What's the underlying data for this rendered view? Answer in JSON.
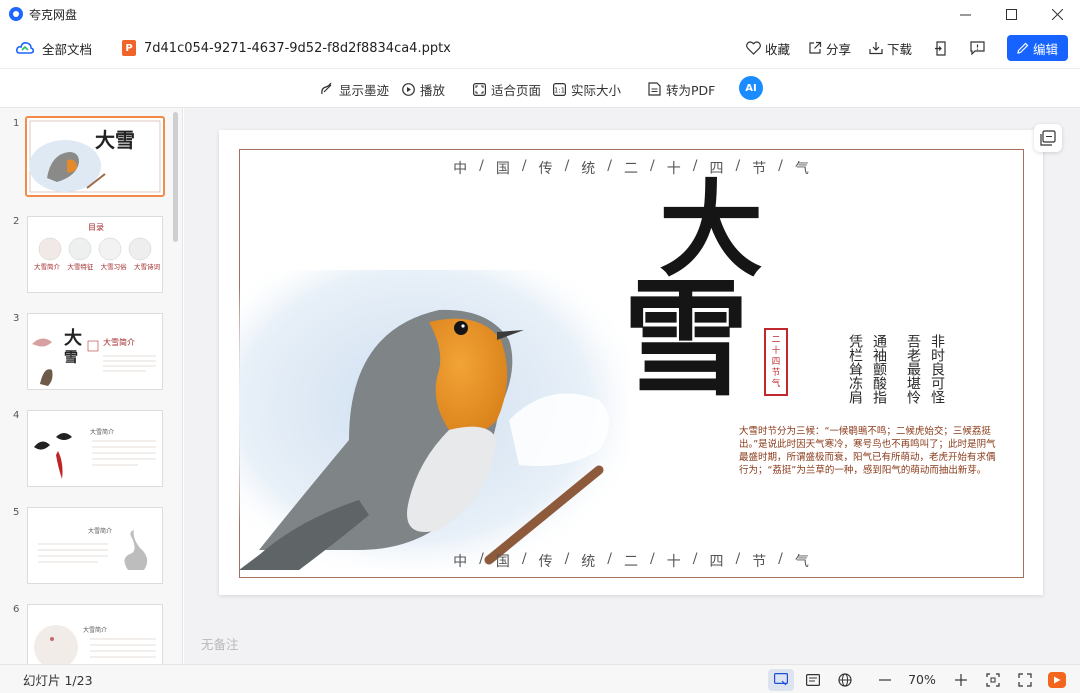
{
  "app": {
    "title": "夸克网盘"
  },
  "header": {
    "all_docs_label": "全部文档",
    "file_name": "7d41c054-9271-4637-9d52-f8d2f8834ca4.pptx",
    "favorite_label": "收藏",
    "share_label": "分享",
    "download_label": "下载",
    "edit_label": "编辑"
  },
  "toolbar": {
    "show_ink_label": "显示墨迹",
    "play_label": "播放",
    "fit_page_label": "适合页面",
    "actual_size_label": "实际大小",
    "to_pdf_label": "转为PDF",
    "ai_label": "AI"
  },
  "sidebar": {
    "thumbnails": [
      {
        "number": "1",
        "title": "大雪",
        "active": true
      },
      {
        "number": "2",
        "title": "目录",
        "items": [
          "大雪简介",
          "大雪特征",
          "大雪习俗",
          "大雪诗词"
        ]
      },
      {
        "number": "3",
        "title": "大雪简介"
      },
      {
        "number": "4",
        "title": "大雪简介"
      },
      {
        "number": "5",
        "title": "大雪简介"
      },
      {
        "number": "6",
        "title": "大雪简介"
      }
    ]
  },
  "slide": {
    "ribbon_chars": [
      "中",
      "/",
      "国",
      "/",
      "传",
      "/",
      "统",
      "/",
      "二",
      "/",
      "十",
      "/",
      "四",
      "/",
      "节",
      "/",
      "气"
    ],
    "big_title_top": "大",
    "big_title_bottom": "雪",
    "seal_text": [
      "二",
      "十",
      "四",
      "节",
      "气"
    ],
    "poem_columns": [
      "非时良可怪",
      "吾老最堪怜",
      "通袖颤酸指",
      "凭栏耸冻肩"
    ],
    "description": "大雪时节分为三候：“一候鹖鴠不鸣；二候虎始交；三候荔挺出。”是说此时因天气寒冷，寒号鸟也不再鸣叫了；此时是阴气最盛时期，所谓盛极而衰，阳气已有所萌动，老虎开始有求偶行为；“荔挺”为兰草的一种，感到阳气的萌动而抽出新芽。"
  },
  "notes": {
    "placeholder": "无备注"
  },
  "status": {
    "slide_counter": "幻灯片 1/23",
    "zoom": "70%"
  },
  "colors": {
    "accent": "#1763ff",
    "frame": "#a0725c",
    "seal": "#c0282e",
    "active_thumb": "#f28a4a"
  }
}
